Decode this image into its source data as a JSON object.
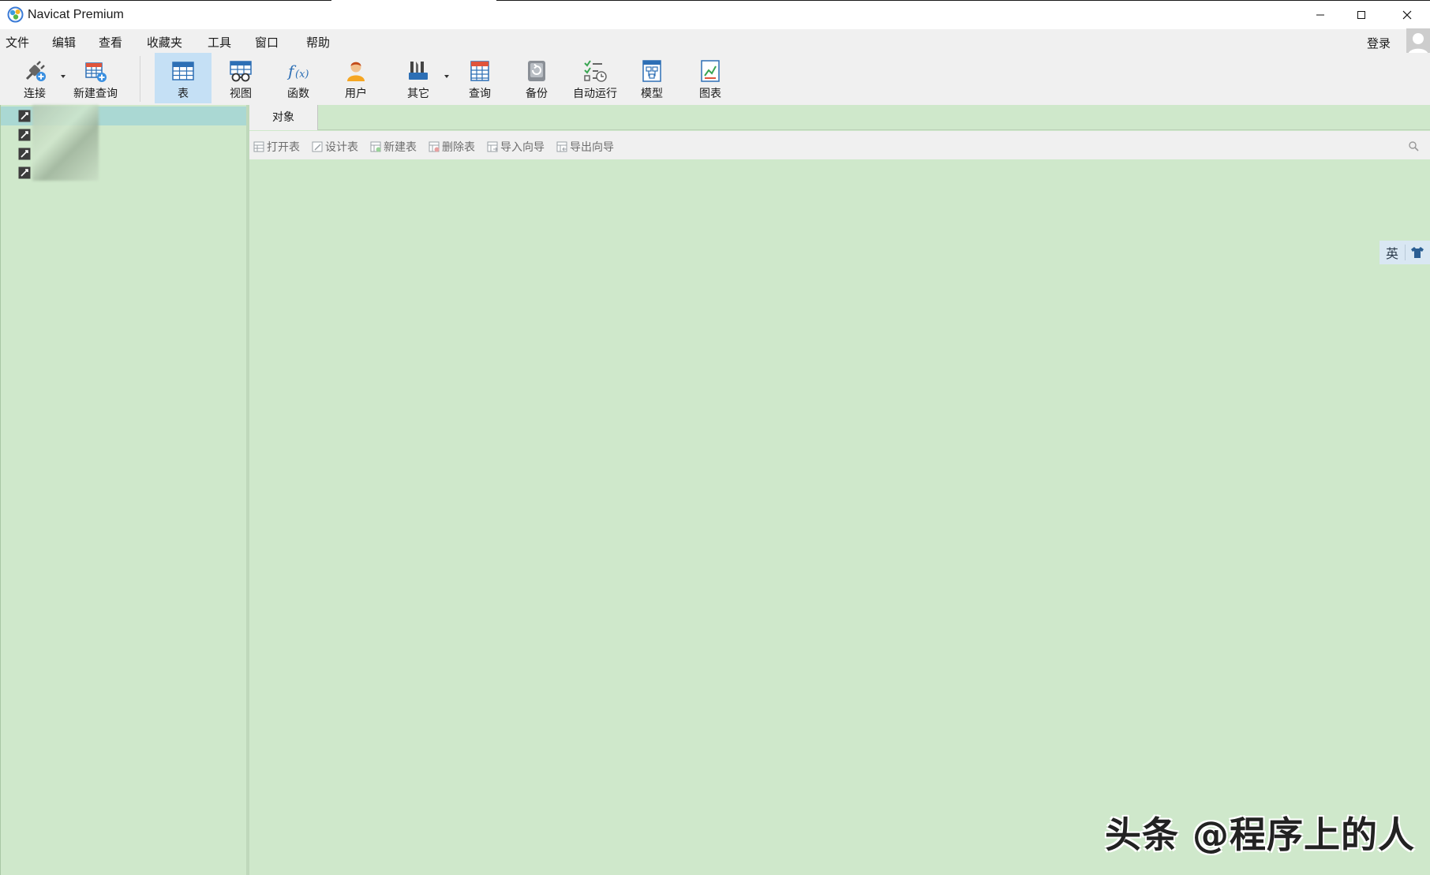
{
  "window": {
    "title": "Navicat Premium"
  },
  "menu": {
    "items": [
      "文件",
      "编辑",
      "查看",
      "收藏夹",
      "工具",
      "窗口",
      "帮助"
    ],
    "login": "登录"
  },
  "toolbar": {
    "items": [
      {
        "label": "连接",
        "icon": "plug-icon"
      },
      {
        "label": "新建查询",
        "icon": "new-query-icon"
      },
      {
        "label": "表",
        "icon": "table-icon",
        "active": true
      },
      {
        "label": "视图",
        "icon": "view-icon"
      },
      {
        "label": "函数",
        "icon": "function-icon"
      },
      {
        "label": "用户",
        "icon": "user-icon"
      },
      {
        "label": "其它",
        "icon": "tools-icon"
      },
      {
        "label": "查询",
        "icon": "query-icon"
      },
      {
        "label": "备份",
        "icon": "backup-icon"
      },
      {
        "label": "自动运行",
        "icon": "schedule-icon"
      },
      {
        "label": "模型",
        "icon": "model-icon"
      },
      {
        "label": "图表",
        "icon": "chart-icon"
      }
    ]
  },
  "main": {
    "tab": "对象",
    "object_toolbar": [
      "打开表",
      "设计表",
      "新建表",
      "删除表",
      "导入向导",
      "导出向导"
    ]
  },
  "ime": {
    "lang": "英"
  },
  "watermark": "头条 @程序上的人",
  "colors": {
    "panel": "#cfe8cb",
    "selected_row": "#aad8d3",
    "active_tool": "#c5e0f5"
  }
}
